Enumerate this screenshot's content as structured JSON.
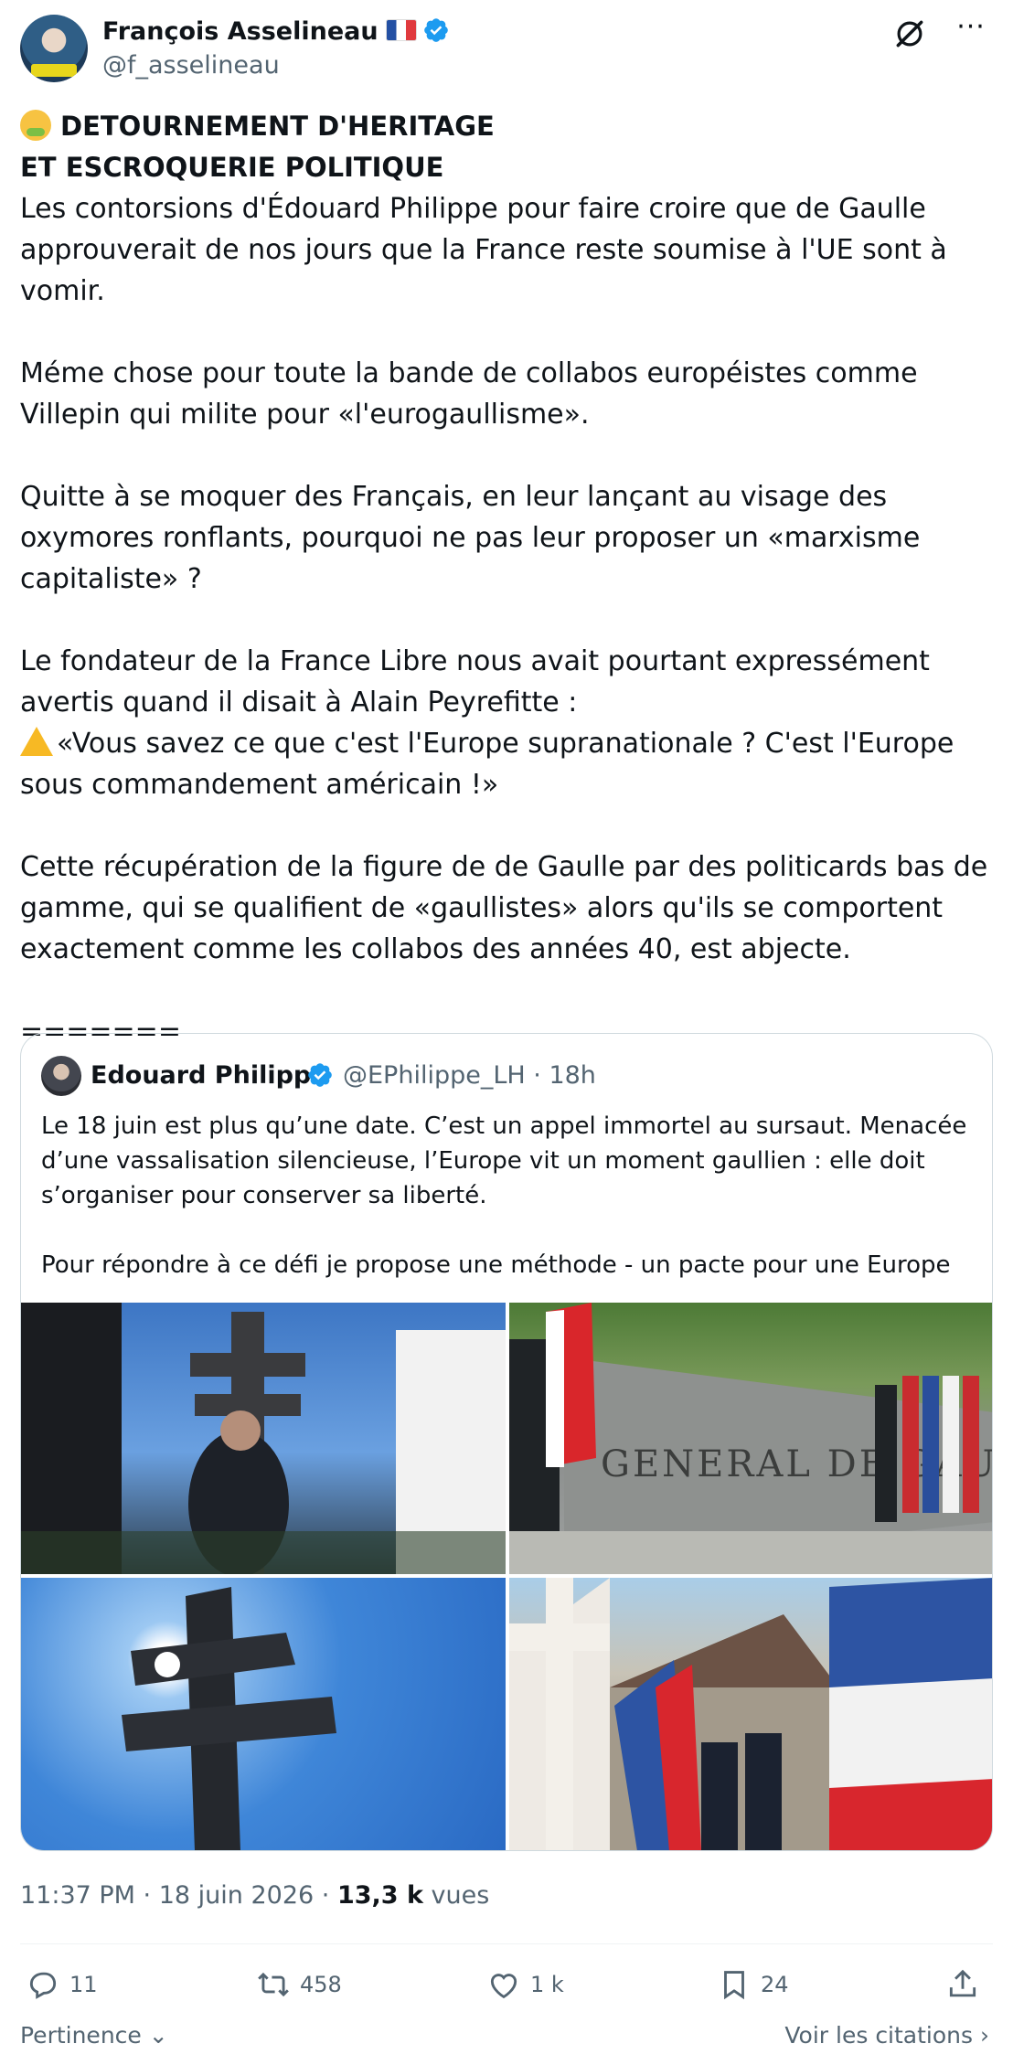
{
  "author": {
    "name": "François Asselineau",
    "handle": "@f_asselineau"
  },
  "tweet": {
    "heading_line1": "DETOURNEMENT D'HERITAGE",
    "heading_line2": "ET ESCROQUERIE POLITIQUE",
    "paragraph1": "Les contorsions d'Édouard Philippe pour faire croire que de Gaulle approuverait de nos jours que la France reste soumise à l'UE sont à vomir.",
    "paragraph2": "Méme chose pour toute la bande de collabos européistes comme Villepin qui milite pour «l'eurogaullisme».",
    "paragraph3": "Quitte à se moquer des Français, en leur lançant au visage des oxymores ronflants, pourquoi ne pas leur proposer un «marxisme capitaliste» ?",
    "paragraph4_line1": "Le fondateur de la France Libre nous avait pourtant expressément avertis quand il disait à Alain Peyrefitte :",
    "paragraph4_quote": "«Vous savez ce que c'est l'Europe supranationale ? C'est l'Europe sous commandement américain !»",
    "paragraph5": "Cette récupération de la figure de de Gaulle par des politicards bas de gamme, qui se qualifient de «gaullistes» alors qu'ils se comportent exactement comme les collabos des années 40, est abjecte.",
    "separator": "======="
  },
  "quoted": {
    "name": "Edouard Philippe",
    "handle_time": "@EPhilippe_LH · 18h",
    "text1": "Le 18 juin est plus qu’une date. C’est un appel immortel au sursaut. Menacée d’une vassalisation silencieuse, l’Europe vit un moment gaullien : elle doit s’organiser pour conserver sa liberté.",
    "text2": "Pour répondre à ce défi je propose une méthode - un pacte pour une Europe …",
    "image3_caption": "GENERAL DE GAULLE"
  },
  "meta": {
    "datetime": "11:37 PM · 18 juin 2026 · ",
    "views_count": "13,3 k",
    "views_label": " vues"
  },
  "actions": {
    "replies": "11",
    "reposts": "458",
    "likes": "1 k",
    "bookmarks": "24"
  },
  "footer": {
    "sort_label": "Pertinence",
    "quotes_link": "Voir les citations"
  },
  "colors": {
    "verified": "#1d9bf0",
    "text": "#0f1419",
    "muted": "#536471"
  }
}
